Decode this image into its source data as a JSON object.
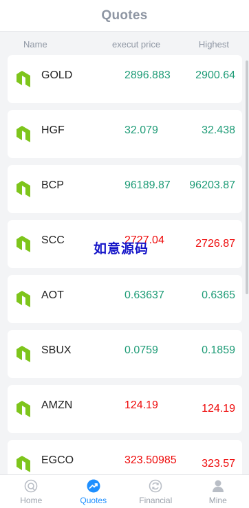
{
  "header": {
    "title": "Quotes"
  },
  "columns": {
    "name": "Name",
    "price": "execut price",
    "high": "Highest"
  },
  "quotes": [
    {
      "symbol": "GOLD",
      "price": "2896.883",
      "high": "2900.64",
      "trend": "up"
    },
    {
      "symbol": "HGF",
      "price": "32.079",
      "high": "32.438",
      "trend": "up"
    },
    {
      "symbol": "BCP",
      "price": "96189.87",
      "high": "96203.87",
      "trend": "up"
    },
    {
      "symbol": "SCC",
      "price": "2727.04",
      "high": "2726.87",
      "trend": "down"
    },
    {
      "symbol": "AOT",
      "price": "0.63637",
      "high": "0.6365",
      "trend": "up"
    },
    {
      "symbol": "SBUX",
      "price": "0.0759",
      "high": "0.1859",
      "trend": "up"
    },
    {
      "symbol": "AMZN",
      "price": "124.19",
      "high": "124.19",
      "trend": "down"
    },
    {
      "symbol": "EGCO",
      "price": "323.50985",
      "high": "323.57",
      "trend": "down"
    }
  ],
  "watermark": "如意源码",
  "tabs": [
    {
      "label": "Home",
      "icon": "home-icon"
    },
    {
      "label": "Quotes",
      "icon": "quotes-trend-icon"
    },
    {
      "label": "Financial",
      "icon": "financial-icon"
    },
    {
      "label": "Mine",
      "icon": "user-icon"
    }
  ],
  "colors": {
    "up": "#1f9c77",
    "down": "#ee0a0a",
    "active_tab": "#1e8fff",
    "logo": "#7ec51c"
  }
}
